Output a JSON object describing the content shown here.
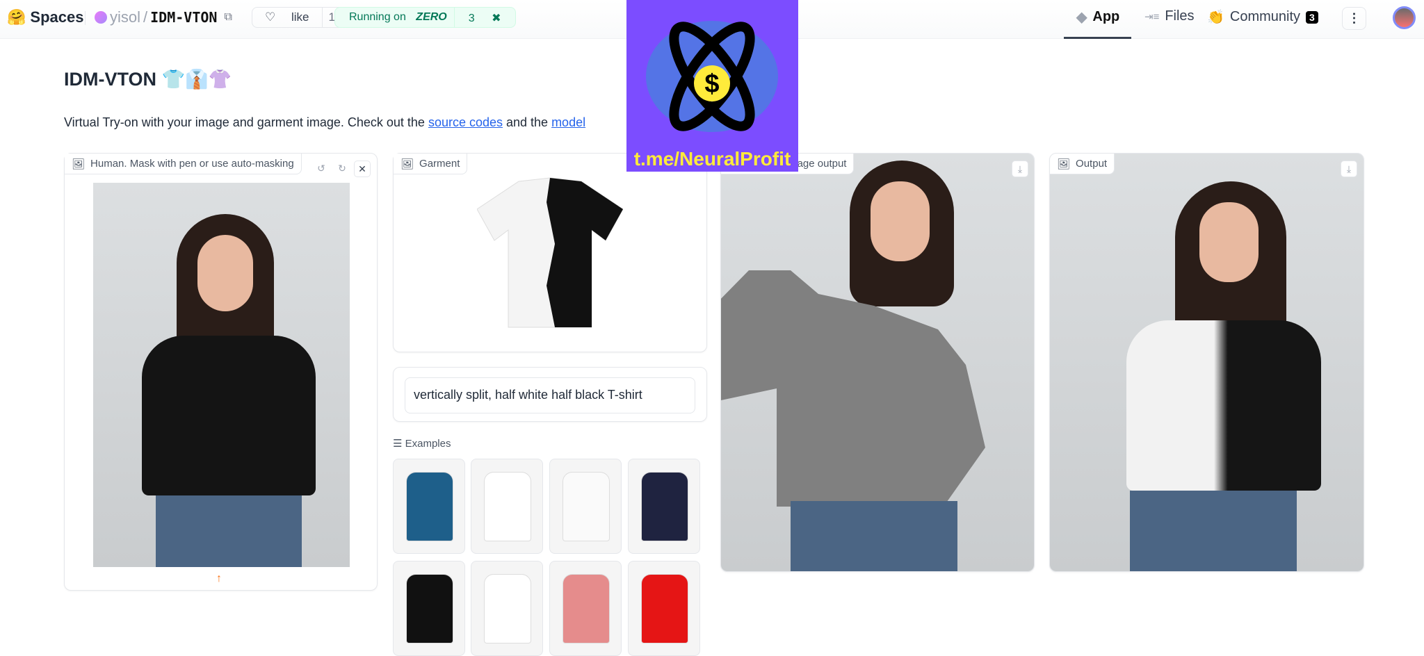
{
  "header": {
    "brand": "Spaces",
    "owner": "yisol",
    "repo": "IDM-VTON",
    "like_label": "like",
    "like_count": "116",
    "running_label": "Running on",
    "running_hw": "ZERO",
    "running_count": "3",
    "tabs": [
      {
        "label": "App",
        "active": true
      },
      {
        "label": "Files"
      },
      {
        "label": "Community",
        "badge": "3"
      }
    ]
  },
  "page": {
    "title": "IDM-VTON 👕👔👚",
    "desc_prefix": "Virtual Try-on with your image and garment image. Check out the ",
    "link1": "source codes",
    "desc_mid": " and the ",
    "link2": "model"
  },
  "human": {
    "label": "Human. Mask with pen or use auto-masking"
  },
  "garment": {
    "label": "Garment"
  },
  "prompt": {
    "value": "vertically split, half white half black T-shirt"
  },
  "examples": {
    "label": "Examples",
    "colors": [
      "#1e5f8a",
      "#ffffff",
      "#fafafa",
      "#1f2340",
      "#111111",
      "#ffffff",
      "#e58c8c",
      "#e51515"
    ]
  },
  "masked": {
    "label": "Masked image output"
  },
  "output": {
    "label": "Output"
  },
  "watermark": {
    "text": "t.me/NeuralProfit"
  }
}
